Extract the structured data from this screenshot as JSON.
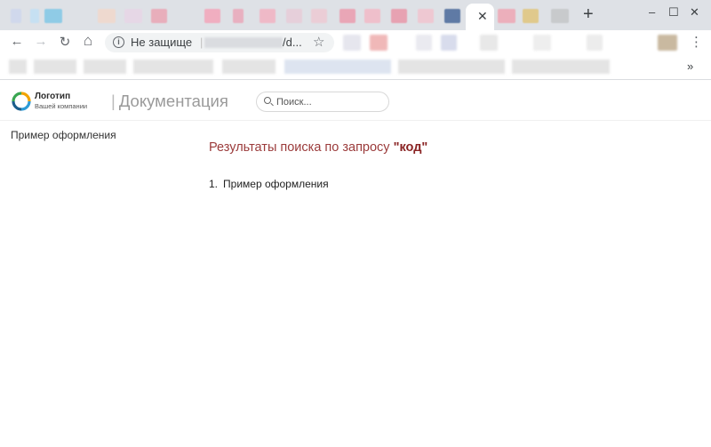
{
  "browser": {
    "active_tab_close": "✕",
    "new_tab": "+",
    "window_controls": {
      "minimize": "–",
      "maximize": "☐",
      "close": "✕"
    },
    "nav": {
      "back": "←",
      "forward": "→",
      "reload": "↻",
      "home": "⌂"
    },
    "omnibox": {
      "security_text": "Не защище",
      "separator": "|",
      "url_visible": "/d...",
      "star": "☆"
    },
    "menu": "⋮",
    "bookmarks_more": "»"
  },
  "site": {
    "logo": {
      "name": "Логотип",
      "tagline": "Вашей компании"
    },
    "title_separator": "|",
    "title": "Документация",
    "search": {
      "placeholder": "Поиск...",
      "value": ""
    }
  },
  "sidebar": {
    "items": [
      {
        "label": "Пример оформления"
      }
    ]
  },
  "results": {
    "heading_prefix": "Результаты поиска по запросу ",
    "query": "\"код\"",
    "items": [
      {
        "number": "1.",
        "label": "Пример оформления"
      }
    ]
  },
  "colors": {
    "heading": "#9b3b3b",
    "query": "#8a2424",
    "title": "#9a9a9a"
  },
  "icons": [
    "back-icon",
    "forward-icon",
    "reload-icon",
    "home-icon",
    "info-icon",
    "star-icon",
    "menu-icon",
    "search-icon",
    "logo-icon"
  ]
}
